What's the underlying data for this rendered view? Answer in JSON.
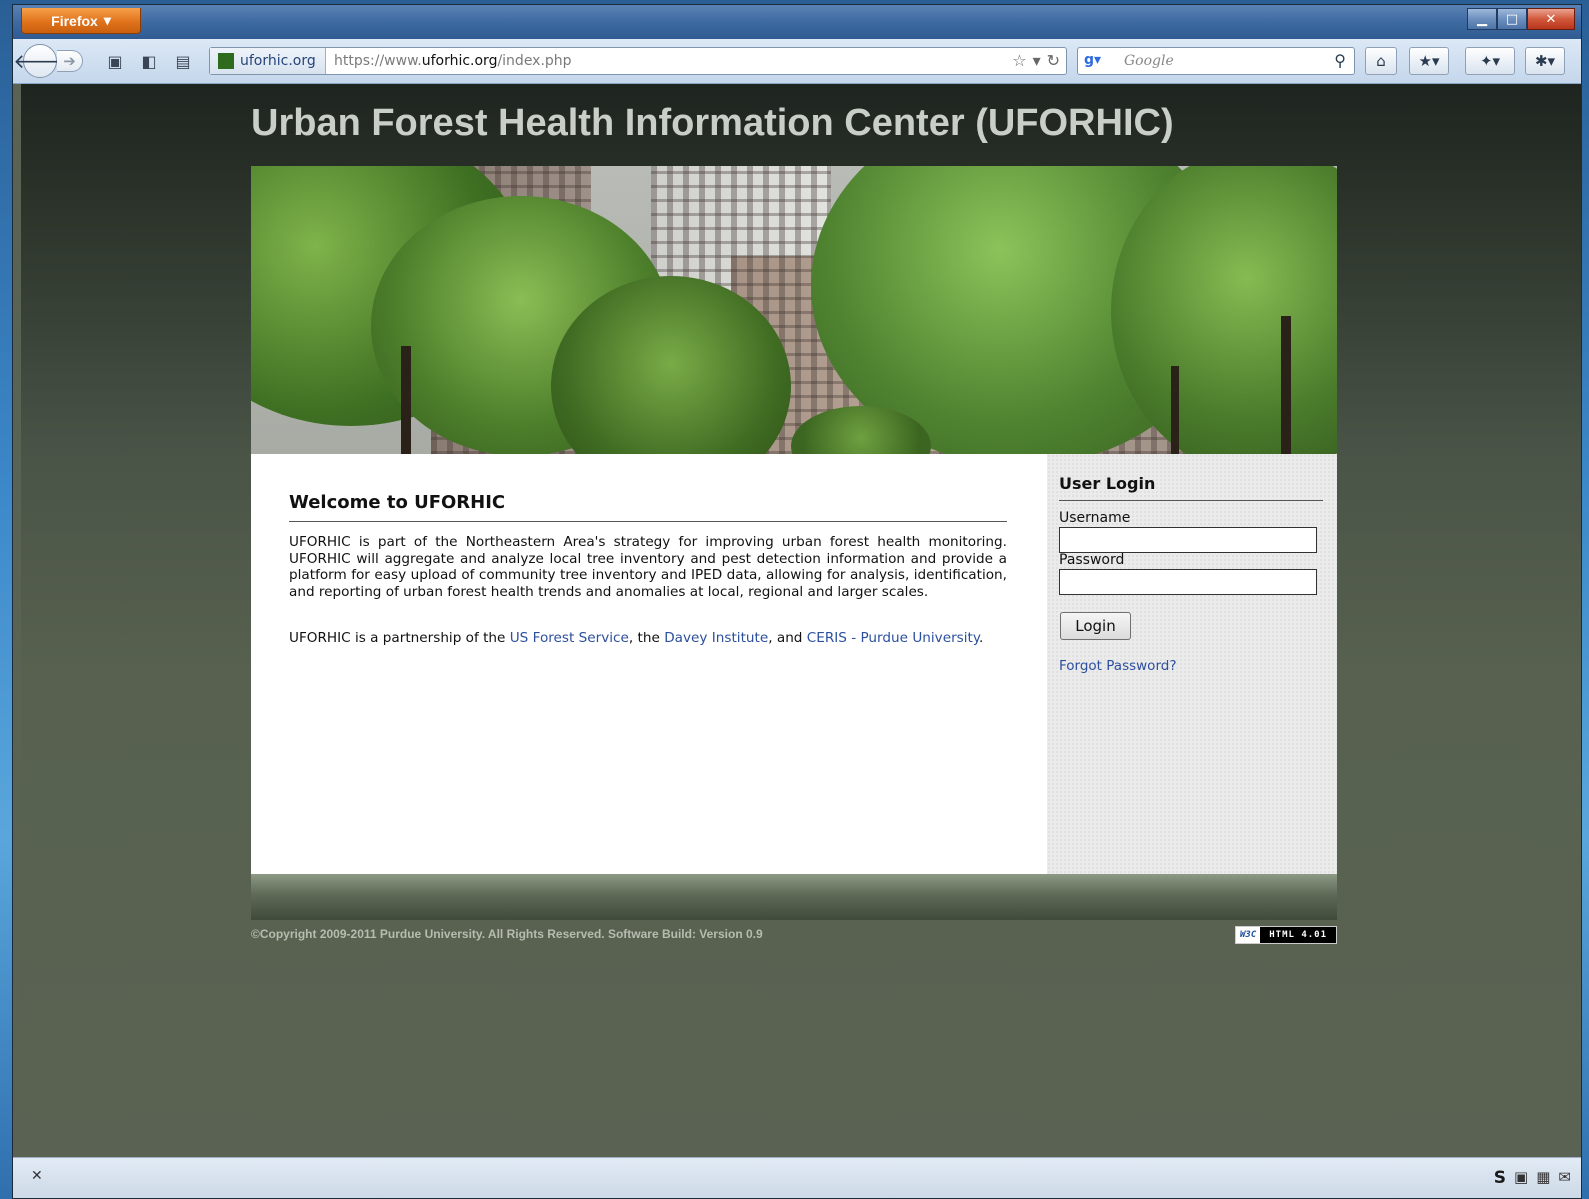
{
  "browser": {
    "menu_button": "Firefox",
    "identity": "uforhic.org",
    "url_prefix": "https://www.",
    "url_host": "uforhic.org",
    "url_path": "/index.php",
    "search_placeholder": "Google"
  },
  "page": {
    "title": "Urban Forest Health Information Center (UFORHIC)"
  },
  "welcome": {
    "heading": "Welcome to UFORHIC",
    "paragraph": "UFORHIC is part of the Northeastern Area's strategy for improving urban forest health monitoring. UFORHIC will aggregate and analyze local tree inventory and pest detection information and provide a platform for easy upload of community tree inventory and IPED data, allowing for analysis, identification, and reporting of urban forest health trends and anomalies at local, regional and larger scales.",
    "partner_prefix": "UFORHIC is a partnership of the ",
    "link_forest_service": "US Forest Service",
    "sep1": ", the ",
    "link_davey": "Davey Institute",
    "sep2": ", and ",
    "link_ceris": "CERIS - Purdue University",
    "end": "."
  },
  "login": {
    "title": "User Login",
    "username_label": "Username",
    "username_value": "",
    "password_label": "Password",
    "password_value": "",
    "button": "Login",
    "forgot": "Forgot Password?"
  },
  "footer": {
    "copyright": "©Copyright 2009-2011 Purdue University. All Rights Reserved.  Software Build: Version 0.9",
    "w3c_left": "W3C",
    "w3c_right": "HTML 4.01"
  },
  "icons": {
    "back": "arrow-left-icon",
    "forward": "arrow-right-icon",
    "bookmark": "star-icon",
    "reload": "reload-icon",
    "search": "magnifier-icon",
    "home": "home-icon"
  }
}
